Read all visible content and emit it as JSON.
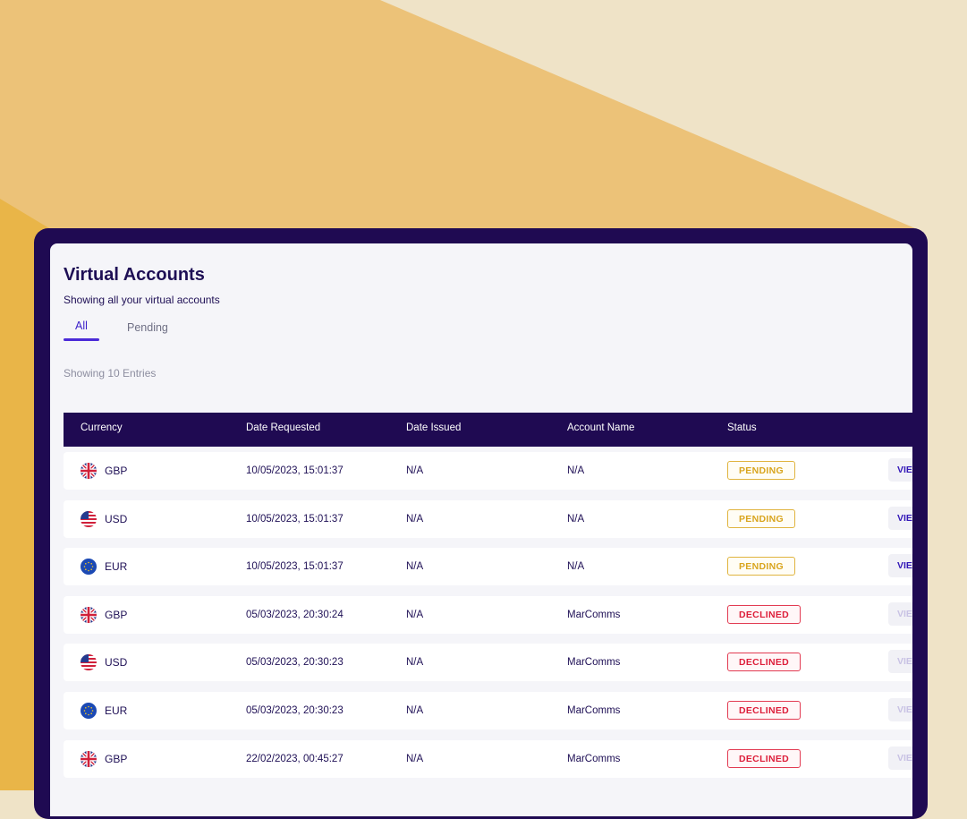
{
  "page": {
    "title": "Virtual Accounts",
    "subtitle": "Showing all your virtual accounts",
    "tabs": [
      {
        "label": "All",
        "active": true
      },
      {
        "label": "Pending",
        "active": false
      }
    ],
    "entries_text": "Showing 10 Entries"
  },
  "table": {
    "headers": [
      "Currency",
      "Date Requested",
      "Date Issued",
      "Account Name",
      "Status"
    ],
    "view_label": "VIEW",
    "rows": [
      {
        "flag": "uk-flag",
        "currency": "GBP",
        "date_requested": "10/05/2023, 15:01:37",
        "date_issued": "N/A",
        "account_name": "N/A",
        "status": "PENDING",
        "status_type": "pending"
      },
      {
        "flag": "us-flag",
        "currency": "USD",
        "date_requested": "10/05/2023, 15:01:37",
        "date_issued": "N/A",
        "account_name": "N/A",
        "status": "PENDING",
        "status_type": "pending"
      },
      {
        "flag": "eu-flag",
        "currency": "EUR",
        "date_requested": "10/05/2023, 15:01:37",
        "date_issued": "N/A",
        "account_name": "N/A",
        "status": "PENDING",
        "status_type": "pending"
      },
      {
        "flag": "uk-flag",
        "currency": "GBP",
        "date_requested": "05/03/2023, 20:30:24",
        "date_issued": "N/A",
        "account_name": "MarComms",
        "status": "DECLINED",
        "status_type": "declined"
      },
      {
        "flag": "us-flag",
        "currency": "USD",
        "date_requested": "05/03/2023, 20:30:23",
        "date_issued": "N/A",
        "account_name": "MarComms",
        "status": "DECLINED",
        "status_type": "declined"
      },
      {
        "flag": "eu-flag",
        "currency": "EUR",
        "date_requested": "05/03/2023, 20:30:23",
        "date_issued": "N/A",
        "account_name": "MarComms",
        "status": "DECLINED",
        "status_type": "declined"
      },
      {
        "flag": "uk-flag",
        "currency": "GBP",
        "date_requested": "22/02/2023, 00:45:27",
        "date_issued": "N/A",
        "account_name": "MarComms",
        "status": "DECLINED",
        "status_type": "declined"
      }
    ]
  },
  "colors": {
    "brand_dark": "#1f0a52",
    "accent": "#4b2ad8",
    "pending": "#d9a51e",
    "declined": "#dd1e3a",
    "background_light": "#efe3c7",
    "background_mid": "#ecc278",
    "background_strong": "#e9b548"
  }
}
